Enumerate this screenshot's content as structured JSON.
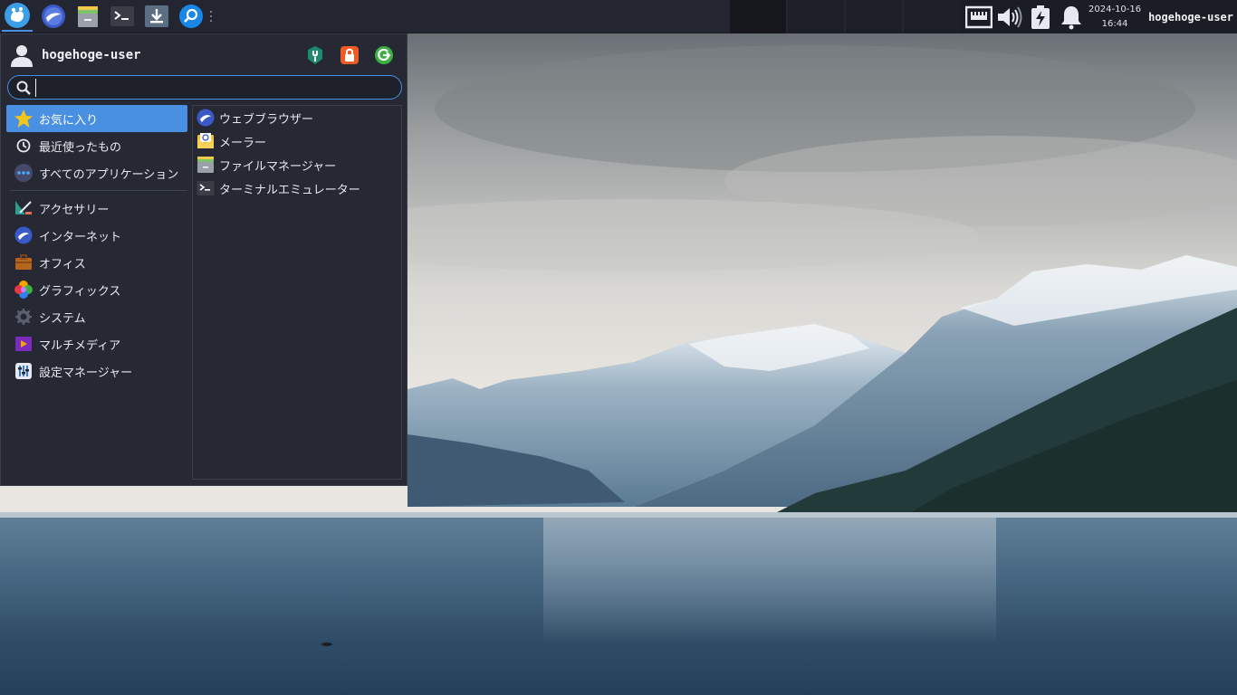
{
  "panel": {
    "launcher_icon": "whisker-menu-icon",
    "launchers": [
      {
        "icon": "web-browser-icon"
      },
      {
        "icon": "file-manager-icon"
      },
      {
        "icon": "terminal-icon"
      },
      {
        "icon": "download-icon"
      },
      {
        "icon": "app-finder-icon"
      }
    ],
    "clock": {
      "date": "2024-10-16",
      "time": "16:44"
    },
    "username": "hogehoge-user",
    "tray_icons": [
      "network-icon",
      "volume-icon",
      "battery-charging-icon",
      "notification-bell-icon"
    ]
  },
  "menu": {
    "user": "hogehoge-user",
    "header_buttons": [
      "settings-manager-icon",
      "lock-screen-icon",
      "logout-icon"
    ],
    "search": {
      "value": "",
      "placeholder": ""
    },
    "categories_top": [
      {
        "label": "お気に入り",
        "icon": "star-icon",
        "selected": true
      },
      {
        "label": "最近使ったもの",
        "icon": "clock-icon"
      },
      {
        "label": "すべてのアプリケーション",
        "icon": "all-apps-icon"
      }
    ],
    "categories": [
      {
        "label": "アクセサリー",
        "icon": "accessories-icon"
      },
      {
        "label": "インターネット",
        "icon": "internet-icon"
      },
      {
        "label": "オフィス",
        "icon": "office-icon"
      },
      {
        "label": "グラフィックス",
        "icon": "graphics-icon"
      },
      {
        "label": "システム",
        "icon": "system-icon"
      },
      {
        "label": "マルチメディア",
        "icon": "multimedia-icon"
      },
      {
        "label": "設定マネージャー",
        "icon": "settings-icon"
      }
    ],
    "apps": [
      {
        "label": "ウェブブラウザー",
        "icon": "web-browser-icon"
      },
      {
        "label": "メーラー",
        "icon": "mail-icon"
      },
      {
        "label": "ファイルマネージャー",
        "icon": "file-manager-icon"
      },
      {
        "label": "ターミナルエミュレーター",
        "icon": "terminal-icon"
      }
    ]
  },
  "colors": {
    "accent": "#4a90e2",
    "panel_bg": "#232630",
    "menu_bg": "#262933"
  }
}
